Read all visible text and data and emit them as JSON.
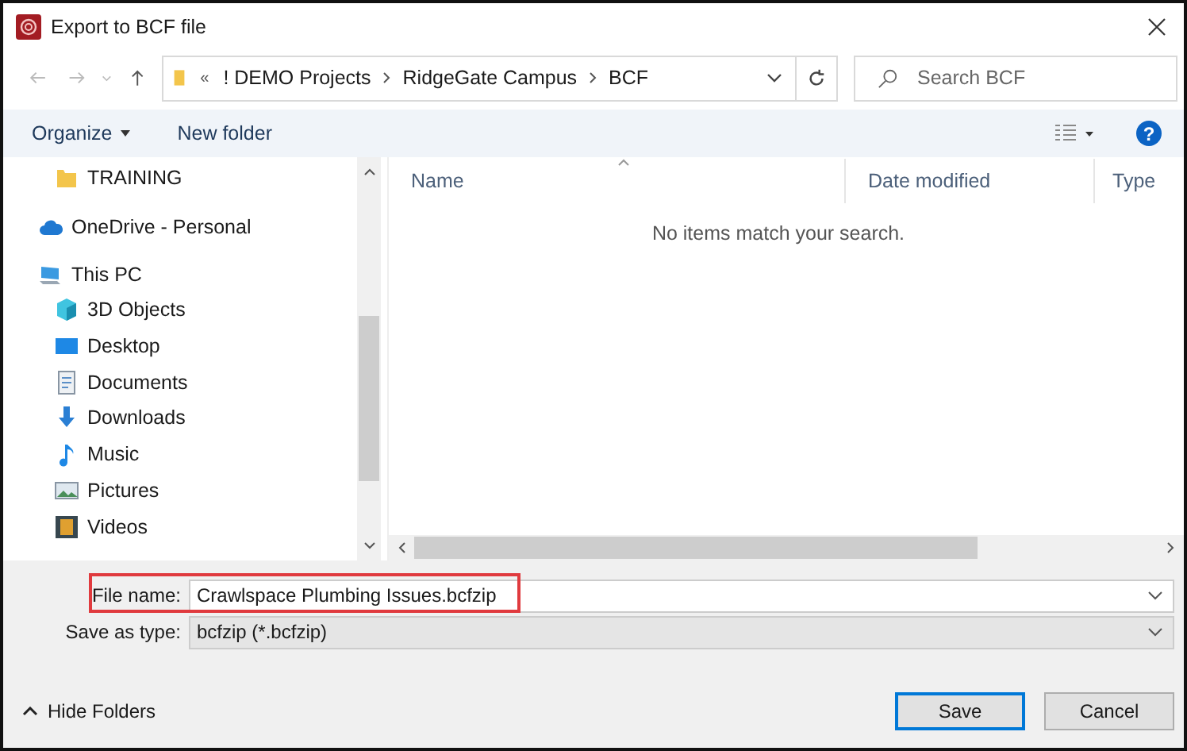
{
  "window": {
    "title": "Export to BCF file"
  },
  "address": {
    "overflow": "«",
    "crumbs": [
      "! DEMO Projects",
      "RidgeGate Campus",
      "BCF"
    ]
  },
  "search": {
    "placeholder": "Search BCF"
  },
  "toolbar": {
    "organize": "Organize",
    "new_folder": "New folder",
    "help": "?"
  },
  "sidebar": {
    "items": [
      {
        "label": "TRAINING",
        "kind": "folder"
      },
      {
        "label": "OneDrive - Personal",
        "kind": "cloud"
      },
      {
        "label": "This PC",
        "kind": "pc",
        "children": [
          {
            "label": "3D Objects",
            "kind": "objects"
          },
          {
            "label": "Desktop",
            "kind": "desktop"
          },
          {
            "label": "Documents",
            "kind": "documents"
          },
          {
            "label": "Downloads",
            "kind": "downloads"
          },
          {
            "label": "Music",
            "kind": "music"
          },
          {
            "label": "Pictures",
            "kind": "pictures"
          },
          {
            "label": "Videos",
            "kind": "videos"
          }
        ]
      }
    ]
  },
  "table": {
    "columns": [
      "Name",
      "Date modified",
      "Type"
    ],
    "empty_message": "No items match your search."
  },
  "form": {
    "file_name": {
      "label": "File name:",
      "value": "Crawlspace Plumbing Issues.bcfzip"
    },
    "save_as_type": {
      "label": "Save as type:",
      "value": "bcfzip (*.bcfzip)"
    }
  },
  "footer": {
    "hide_folders": "Hide Folders",
    "buttons": [
      "Save",
      "Cancel"
    ]
  }
}
